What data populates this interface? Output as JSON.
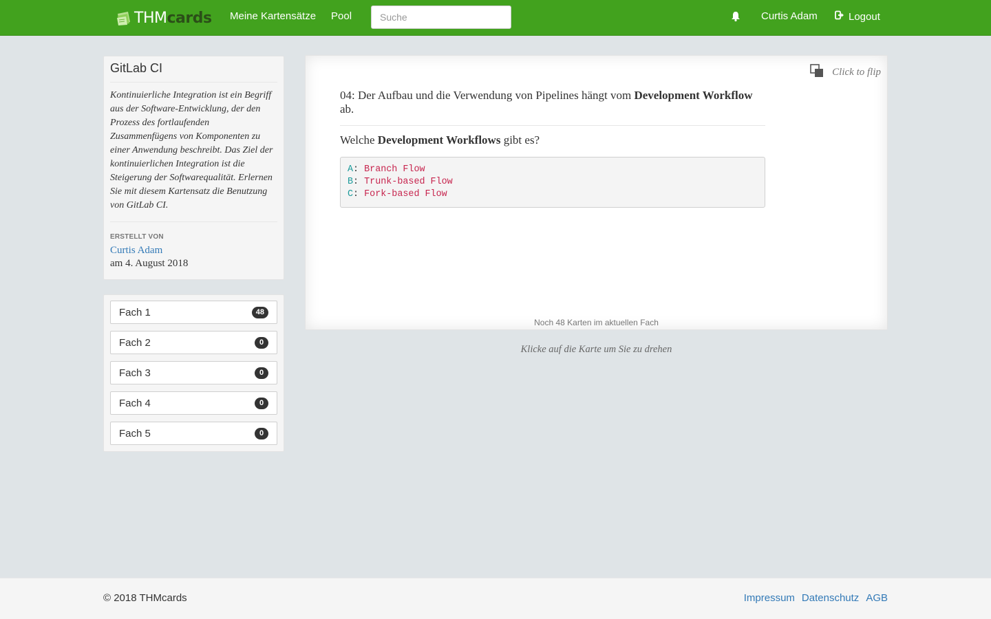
{
  "navbar": {
    "brand_thm": "THM",
    "brand_cards": "cards",
    "links": [
      {
        "label": "Meine Kartensätze"
      },
      {
        "label": "Pool"
      }
    ],
    "search_placeholder": "Suche",
    "user_name": "Curtis Adam",
    "logout_label": "Logout",
    "icons": [
      "thmcards-logo-icon",
      "bell-icon",
      "logout-icon"
    ]
  },
  "cardset": {
    "title": "GitLab CI",
    "description": "Kontinuierliche Integration ist ein Begriff aus der Software-Entwicklung, der den Prozess des fortlaufenden Zusammenfügens von Komponenten zu einer Anwendung beschreibt. Das Ziel der kontinuierlichen Integration ist die Steigerung der Softwarequalität. Erlernen Sie mit diesem Kartensatz die Benutzung von GitLab CI.",
    "created_label": "Erstellt von",
    "author": "Curtis Adam",
    "created_date": "am 4. August 2018"
  },
  "boxes": [
    {
      "label": "Fach 1",
      "count": "48"
    },
    {
      "label": "Fach 2",
      "count": "0"
    },
    {
      "label": "Fach 3",
      "count": "0"
    },
    {
      "label": "Fach 4",
      "count": "0"
    },
    {
      "label": "Fach 5",
      "count": "0"
    }
  ],
  "card": {
    "flip_label": "Click to flip",
    "question_prefix": "04: Der Aufbau und die Verwendung von Pipelines hängt vom ",
    "question_bold": "Development Workflow",
    "question_suffix": " ab.",
    "sub_prefix": "Welche ",
    "sub_bold": "Development Workflows",
    "sub_suffix": " gibt es?",
    "code_lines": [
      {
        "key": "A",
        "sep": ": ",
        "value": "Branch Flow"
      },
      {
        "key": "B",
        "sep": ": ",
        "value": "Trunk-based Flow"
      },
      {
        "key": "C",
        "sep": ": ",
        "value": "Fork-based Flow"
      }
    ],
    "footer": "Noch 48 Karten im aktuellen Fach"
  },
  "hint": "Klicke auf die Karte um Sie zu drehen",
  "footer": {
    "copyright": "© 2018 THMcards",
    "links": [
      {
        "label": "Impressum"
      },
      {
        "label": "Datenschutz"
      },
      {
        "label": "AGB"
      }
    ]
  },
  "colors": {
    "navbar": "#42a21e",
    "link": "#337ab7",
    "badge": "#333333",
    "code_value": "#c7254e",
    "code_key": "#1b9a9a"
  }
}
